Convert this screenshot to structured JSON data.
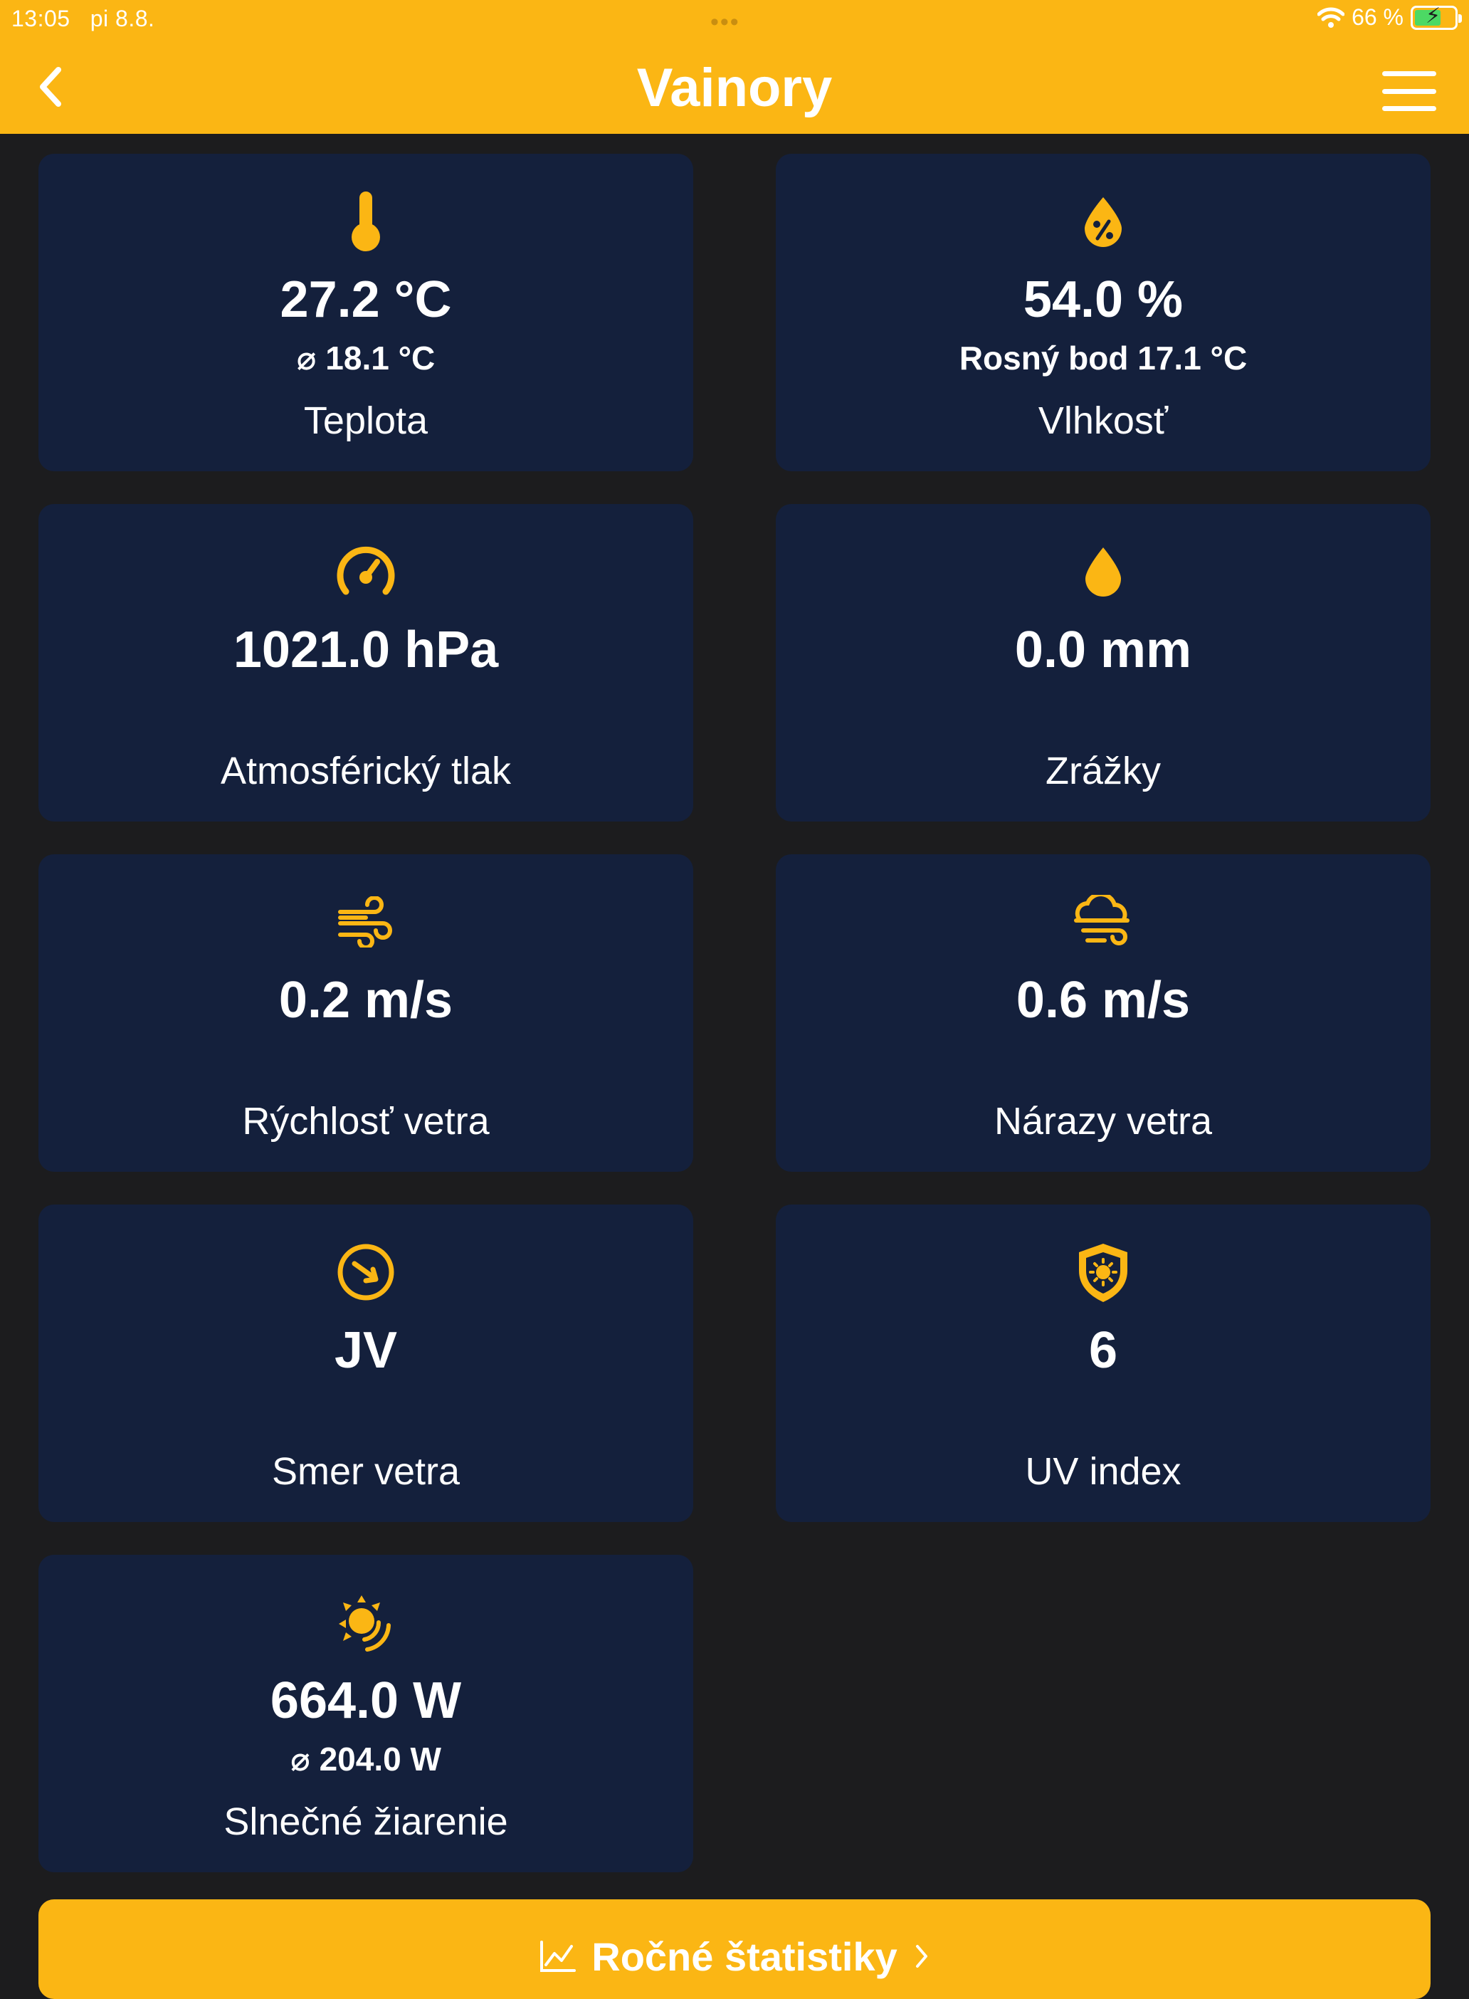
{
  "status_bar": {
    "time": "13:05",
    "date": "pi 8.8.",
    "battery": "66 %",
    "battery_level": 0.66
  },
  "header": {
    "title": "Vainory"
  },
  "cards": [
    {
      "icon": "thermometer-icon",
      "value": "27.2 °C",
      "sub": "⌀ 18.1 °C",
      "label": "Teplota"
    },
    {
      "icon": "humidity-drop-icon",
      "value": "54.0 %",
      "sub": "Rosný bod 17.1 °C",
      "label": "Vlhkosť"
    },
    {
      "icon": "gauge-icon",
      "value": "1021.0 hPa",
      "sub": "",
      "label": "Atmosférický tlak"
    },
    {
      "icon": "rain-drop-icon",
      "value": "0.0 mm",
      "sub": "",
      "label": "Zrážky"
    },
    {
      "icon": "wind-icon",
      "value": "0.2 m/s",
      "sub": "",
      "label": "Rýchlosť vetra"
    },
    {
      "icon": "wind-gust-cloud-icon",
      "value": "0.6 m/s",
      "sub": "",
      "label": "Nárazy vetra"
    },
    {
      "icon": "compass-arrow-icon",
      "value": "JV",
      "sub": "",
      "label": "Smer vetra"
    },
    {
      "icon": "uv-shield-icon",
      "value": "6",
      "sub": "",
      "label": "UV index"
    },
    {
      "icon": "sun-radiation-icon",
      "value": "664.0 W",
      "sub": "⌀ 204.0 W",
      "label": "Slnečné žiarenie"
    }
  ],
  "footer": {
    "stats_label": "Ročné štatistiky"
  },
  "colors": {
    "accent": "#fbb614",
    "card": "#14203c",
    "background": "#1c1c1e"
  }
}
